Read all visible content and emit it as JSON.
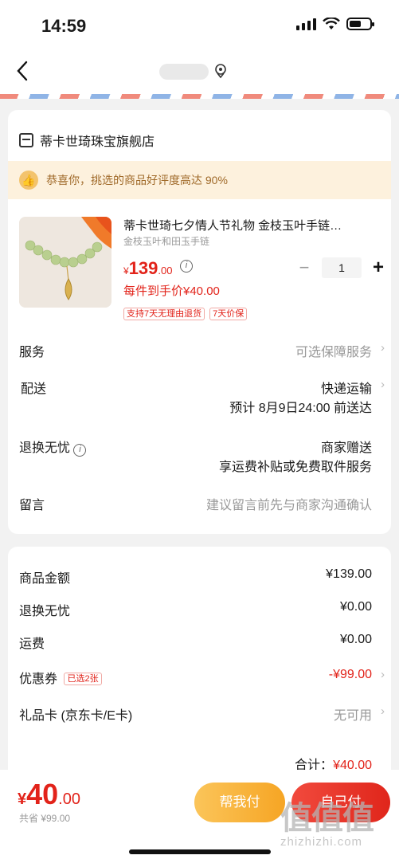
{
  "status": {
    "time": "14:59"
  },
  "shop": {
    "name": "蒂卡世琦珠宝旗舰店"
  },
  "banner": {
    "text": "恭喜你，挑选的商品好评度高达 90%"
  },
  "product": {
    "title": "蒂卡世琦七夕情人节礼物 金枝玉叶手链…",
    "sku": "金枝玉叶和田玉手链",
    "price_symbol": "¥",
    "price_int": "139",
    "price_dec": ".00",
    "quantity": "1",
    "unit_price": "每件到手价¥40.00",
    "tags": [
      "支持7天无理由退货",
      "7天价保"
    ]
  },
  "rows": {
    "service": {
      "label": "服务",
      "value": "可选保障服务"
    },
    "delivery": {
      "label": "配送",
      "value": "快递运输",
      "sub": "预计 8月9日24:00 前送达"
    },
    "returns": {
      "label": "退换无忧",
      "value": "商家赠送",
      "sub": "享运费补贴或免费取件服务"
    },
    "note": {
      "label": "留言",
      "placeholder": "建议留言前先与商家沟通确认"
    }
  },
  "summary": {
    "goods": {
      "label": "商品金额",
      "value": "¥139.00"
    },
    "returns": {
      "label": "退换无忧",
      "value": "¥0.00"
    },
    "shipping": {
      "label": "运费",
      "value": "¥0.00"
    },
    "coupon": {
      "label": "优惠券",
      "badge": "已选2张",
      "value": "-¥99.00"
    },
    "giftcard": {
      "label": "礼品卡 (京东卡/E卡)",
      "value": "无可用"
    },
    "total_label": "合计：",
    "total_value": "¥40.00"
  },
  "bottom": {
    "pay_symbol": "¥",
    "pay_int": "40",
    "pay_dec": ".00",
    "save_text": "共省 ¥99.00",
    "friend_pay": "帮我付",
    "self_pay": "自己付"
  },
  "watermark": {
    "main": "值值值",
    "sub": "zhizhizhi.com"
  },
  "colors": {
    "accent": "#e2231a",
    "friend_btn": "#f6a524",
    "banner_bg": "#fdf1dd"
  }
}
